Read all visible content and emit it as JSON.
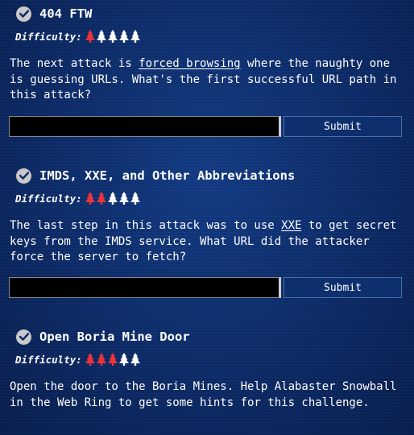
{
  "objectives": [
    {
      "title": "404 FTW",
      "difficulty_label": "Difficulty:",
      "difficulty_level": 1,
      "difficulty_max": 5,
      "description": {
        "before": "The next attack is ",
        "link": "forced browsing",
        "after": " where the naughty one is guessing URLs. What's the first successful URL path in this attack?"
      },
      "submit_label": "Submit",
      "answer_value": ""
    },
    {
      "title": "IMDS, XXE, and Other Abbreviations",
      "difficulty_label": "Difficulty:",
      "difficulty_level": 2,
      "difficulty_max": 5,
      "description": {
        "before": "The last step in this attack was to use ",
        "link": "XXE",
        "after": " to get secret keys from the IMDS service. What URL did the attacker force the server to fetch?"
      },
      "submit_label": "Submit",
      "answer_value": ""
    },
    {
      "title": "Open Boria Mine Door",
      "difficulty_label": "Difficulty:",
      "difficulty_level": 3,
      "difficulty_max": 5,
      "description": {
        "before": "Open the door to the Boria Mines. Help Alabaster Snowball in the Web Ring to get some hints for this challenge.",
        "link": "",
        "after": ""
      }
    }
  ],
  "colors": {
    "tree_active": "#e8343a",
    "tree_inactive": "#ffffff",
    "check_circle": "#c9c9c9",
    "check_mark": "#0c2a66"
  },
  "icons": {
    "completed": "check-circle-icon",
    "difficulty": "tree-icon"
  }
}
